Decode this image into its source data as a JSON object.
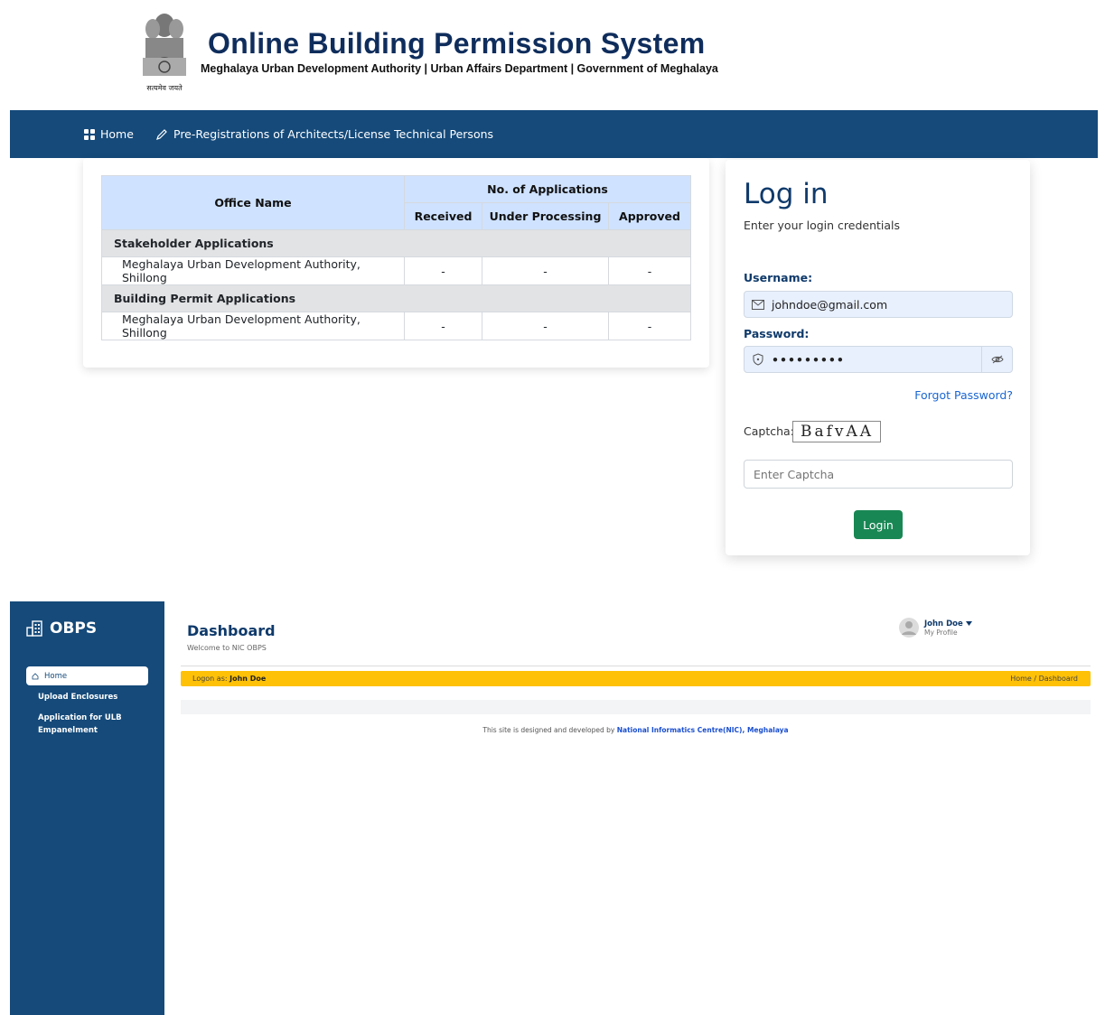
{
  "header": {
    "title": "Online Building Permission System",
    "subtitle": "Meghalaya Urban Development Authority | Urban Affairs Department | Government of Meghalaya",
    "emblem_motto": "सत्यमेव जयते"
  },
  "nav": {
    "home": "Home",
    "prereg": "Pre-Registrations of Architects/License Technical Persons"
  },
  "stats": {
    "office_header": "Office Name",
    "group_header": "No. of Applications",
    "col_received": "Received",
    "col_processing": "Under Processing",
    "col_approved": "Approved",
    "sections": [
      {
        "title": "Stakeholder Applications",
        "office": "Meghalaya Urban Development Authority, Shillong",
        "received": "-",
        "processing": "-",
        "approved": "-"
      },
      {
        "title": "Building Permit Applications",
        "office": "Meghalaya Urban Development Authority, Shillong",
        "received": "-",
        "processing": "-",
        "approved": "-"
      }
    ]
  },
  "login": {
    "title": "Log in",
    "subtitle": "Enter your login credentials",
    "username_label": "Username:",
    "username_value": "johndoe@gmail.com",
    "password_label": "Password:",
    "password_value": "•••••••••",
    "forgot": "Forgot Password?",
    "captcha_label": "Captcha:",
    "captcha_text": "BafvAA",
    "captcha_placeholder": "Enter Captcha",
    "button": "Login"
  },
  "dashboard": {
    "brand": "OBPS",
    "sidebar": {
      "active": "Home",
      "items": [
        "Upload Enclosures",
        "Application for ULB Empanelment"
      ]
    },
    "title": "Dashboard",
    "welcome": "Welcome to NIC OBPS",
    "user_name": "John Doe",
    "user_profile": "My Profile",
    "logon_prefix": "Logon as:",
    "logon_user": "John Doe",
    "breadcrumb": "Home / Dashboard",
    "footer_prefix": "This site is designed and developed by",
    "footer_org": "National Informatics Centre(NIC), Meghalaya"
  },
  "colors": {
    "navy": "#154a7a",
    "table_header": "#cfe2ff",
    "login_green": "#198754",
    "yellow_bar": "#ffc107",
    "link_blue": "#1a66d2"
  }
}
